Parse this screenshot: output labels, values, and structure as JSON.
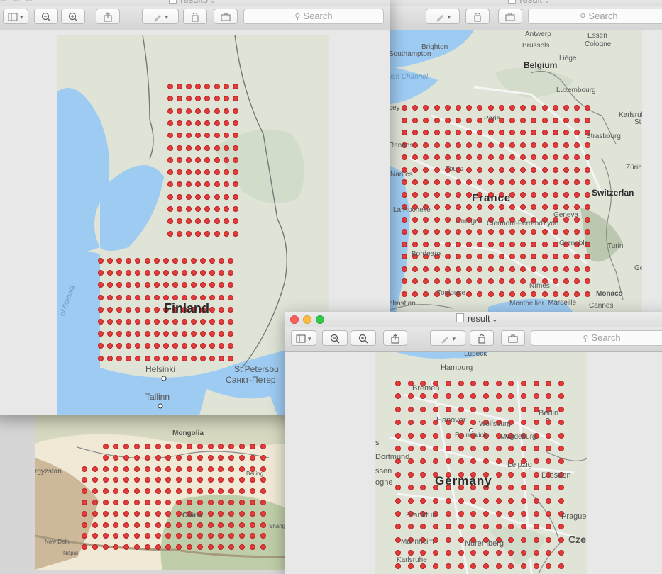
{
  "windows": {
    "finland": {
      "title": "result5",
      "search_placeholder": "Search",
      "map": {
        "country": "Finland",
        "labels": {
          "bothnia": "of Bothnia",
          "helsinki": "Helsinki",
          "st_petersburg": "St Petersbu",
          "st_petersburg_ru": "Санкт-Петер",
          "tallinn": "Tallinn"
        }
      }
    },
    "france": {
      "title": "result",
      "search_placeholder": "Search",
      "map": {
        "country": "France",
        "labels": {
          "belgium": "Belgium",
          "switzerland": "Switzerlan",
          "brighton": "Brighton",
          "southampton": "Southampton",
          "brussels": "Brussels",
          "antwerp": "Antwerp",
          "essen": "Essen",
          "cologne": "Cologne",
          "liege": "Liège",
          "luxembourg": "Luxembourg",
          "paris": "Paris",
          "rennes": "Rennes",
          "nantes": "Nantes",
          "tours": "Tours",
          "la_rochelle": "La Rochelle",
          "limoges": "Limoges",
          "clermont": "Clermont-Ferrand",
          "lyon": "Lyon",
          "bordeaux": "Bordeaux",
          "toulouse": "Toulouse",
          "montpellier": "Montpellier",
          "marseille": "Marseille",
          "nimes": "Nîmes",
          "monaco": "Monaco",
          "geneva": "Geneva",
          "grenoble": "Grenoble",
          "turin": "Turin",
          "zurich": "Zürich",
          "strasbourg": "Strasbourg",
          "karlsruhe": "Karlsruhe",
          "english_channel": "lish Channel",
          "caen": "sey",
          "sebastian": "ebastian",
          "cannes": "Cannes",
          "ge": "Ge",
          "st": "St"
        }
      }
    },
    "china": {
      "map": {
        "labels": {
          "mongolia": "Mongolia",
          "kyrgyzstan": "rgyzstan",
          "china": "China",
          "new_delhi": "New Delhi",
          "nepal": "Nepal",
          "beijing": "Beijing",
          "shanghai": "Shangh"
        }
      }
    },
    "germany": {
      "title": "result",
      "search_placeholder": "Search",
      "map": {
        "country": "Germany",
        "labels": {
          "lubeck": "Lübeck",
          "hamburg": "Hamburg",
          "bremen": "Bremen",
          "berlin": "Berlin",
          "hanover": "Hanover",
          "wolfsburg": "Wolfsburg",
          "brunswick": "Brunswick",
          "magdeburg": "Magdeburg",
          "dortmund": "Dortmund",
          "essen": "ssen",
          "cologne": "ogne",
          "leipzig": "Leipzig",
          "dresden": "Dresden",
          "frankfurt": "Frankfurt",
          "prague": "Prague",
          "czech": "Cze",
          "mannheim": "Mannheim",
          "nuremberg": "Nuremberg",
          "karlsruhe": "Karlsruhe",
          "s": "s"
        }
      }
    }
  },
  "colors": {
    "dot": "#e33c3c",
    "water": "#9ecbf2",
    "land": "#dfe4d7"
  }
}
